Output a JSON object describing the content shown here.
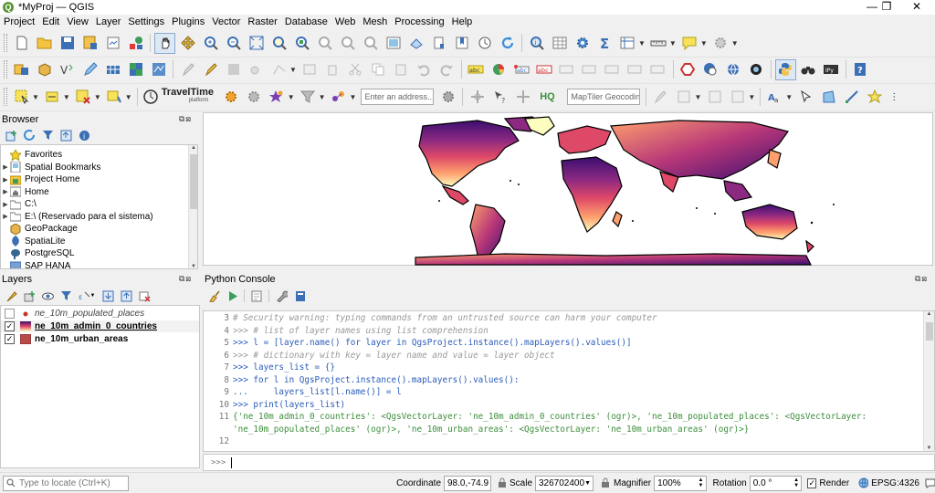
{
  "window": {
    "title": "*MyProj — QGIS",
    "minimize": "—",
    "maximize": "❐",
    "close": "✕"
  },
  "menu": [
    "Project",
    "Edit",
    "View",
    "Layer",
    "Settings",
    "Plugins",
    "Vector",
    "Raster",
    "Database",
    "Web",
    "Mesh",
    "Processing",
    "Help"
  ],
  "toolbar": {
    "address_placeholder": "Enter an address...",
    "maptiler_placeholder": "MapTiler Geocodin...",
    "traveltime_label": "TravelTime",
    "traveltime_sub": "platform",
    "hq_label": "HQ"
  },
  "browser": {
    "title": "Browser",
    "items": [
      {
        "label": "Favorites",
        "icon": "star-icon",
        "expandable": false
      },
      {
        "label": "Spatial Bookmarks",
        "icon": "bookmarks-icon",
        "expandable": true
      },
      {
        "label": "Project Home",
        "icon": "project-home-icon",
        "expandable": true
      },
      {
        "label": "Home",
        "icon": "home-folder-icon",
        "expandable": true
      },
      {
        "label": "C:\\",
        "icon": "folder-icon",
        "expandable": true
      },
      {
        "label": "E:\\ (Reservado para el sistema)",
        "icon": "folder-icon",
        "expandable": true
      },
      {
        "label": "GeoPackage",
        "icon": "geopackage-icon",
        "expandable": false
      },
      {
        "label": "SpatiaLite",
        "icon": "spatialite-icon",
        "expandable": false
      },
      {
        "label": "PostgreSQL",
        "icon": "postgresql-icon",
        "expandable": false
      },
      {
        "label": "SAP HANA",
        "icon": "sap-hana-icon",
        "expandable": false
      }
    ]
  },
  "layers": {
    "title": "Layers",
    "items": [
      {
        "label": "ne_10m_populated_places",
        "checked": false,
        "style": "italic",
        "swatch": "#c0392b"
      },
      {
        "label": "ne_10m_admin_0_countries",
        "checked": true,
        "style": "bold-underline",
        "swatch": "gradient"
      },
      {
        "label": "ne_10m_urban_areas",
        "checked": true,
        "style": "bold",
        "swatch": "#b94a4a"
      }
    ]
  },
  "console": {
    "title": "Python Console",
    "prompt": ">>>",
    "lines": [
      {
        "num": "3",
        "text": "# Security warning: typing commands from an untrusted source can harm your computer"
      },
      {
        "num": "4",
        "text": ">>> # list of layer names using list comprehension"
      },
      {
        "num": "5",
        "text": ">>> l = [layer.name() for layer in QgsProject.instance().mapLayers().values()]"
      },
      {
        "num": "6",
        "text": ">>> # dictionary with key = layer name and value = layer object"
      },
      {
        "num": "7",
        "text": ">>> layers_list = {}"
      },
      {
        "num": "8",
        "text": ">>> for l in QgsProject.instance().mapLayers().values():"
      },
      {
        "num": "9",
        "text": "...     layers_list[l.name()] = l"
      },
      {
        "num": "10",
        "text": ">>> print(layers_list)"
      },
      {
        "num": "11",
        "text": "{'ne_10m_admin_0_countries': <QgsVectorLayer: 'ne_10m_admin_0_countries' (ogr)>, 'ne_10m_populated_places': <QgsVectorLayer:"
      },
      {
        "num": "",
        "text": "'ne_10m_populated_places' (ogr)>, 'ne_10m_urban_areas': <QgsVectorLayer: 'ne_10m_urban_areas' (ogr)>}"
      },
      {
        "num": "12",
        "text": ""
      }
    ]
  },
  "status": {
    "locate_placeholder": "Type to locate (Ctrl+K)",
    "coordinate_label": "Coordinate",
    "coordinate_value": "98.0,-74.9",
    "scale_label": "Scale",
    "scale_value": "326702400",
    "magnifier_label": "Magnifier",
    "magnifier_value": "100%",
    "rotation_label": "Rotation",
    "rotation_value": "0.0 °",
    "render_label": "Render",
    "crs_label": "EPSG:4326"
  }
}
